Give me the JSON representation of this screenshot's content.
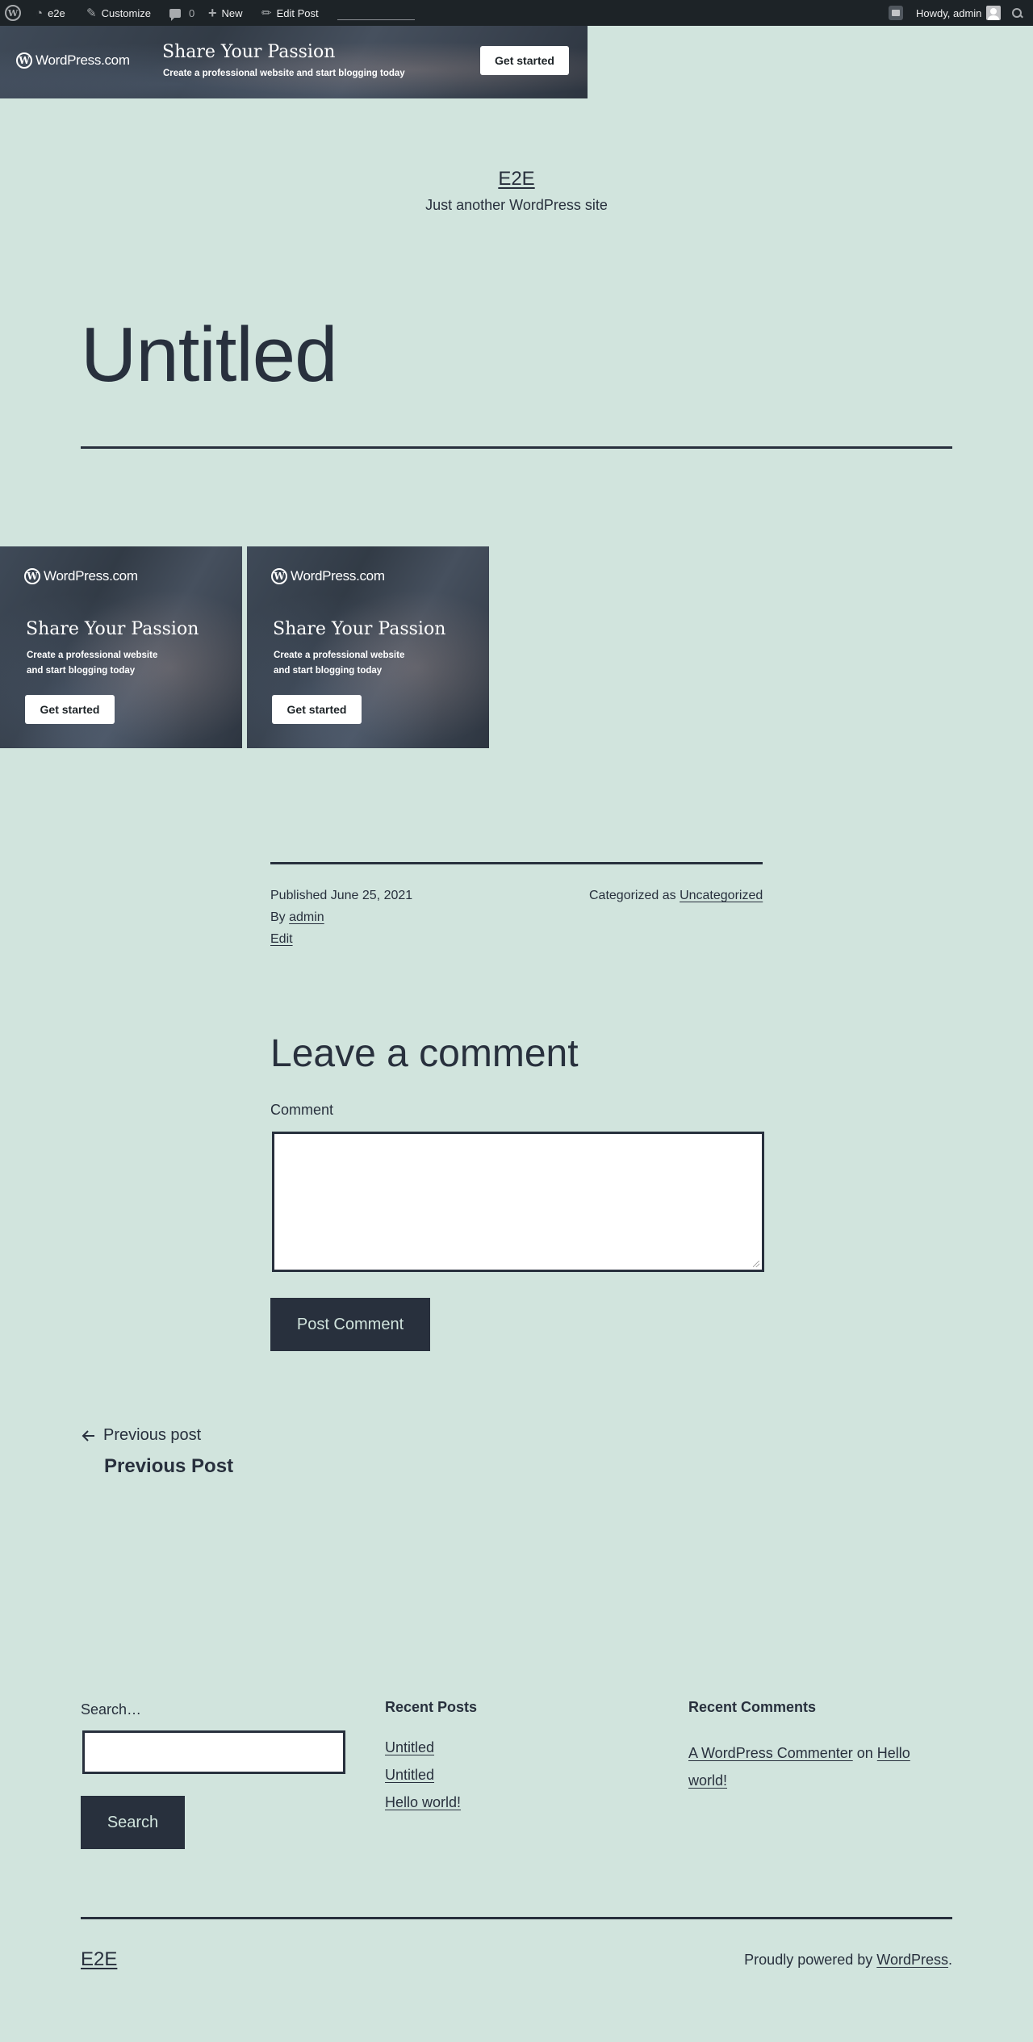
{
  "admin_bar": {
    "site_name": "e2e",
    "customize": "Customize",
    "comments_count": "0",
    "new": "New",
    "edit_post": "Edit Post",
    "howdy": "Howdy, admin"
  },
  "top_ad": {
    "logo_text": "WordPress.com",
    "title": "Share Your Passion",
    "subtitle": "Create a professional website and start blogging today",
    "button": "Get started"
  },
  "header": {
    "site_title": "E2E",
    "tagline": "Just another WordPress site"
  },
  "post": {
    "title": "Untitled"
  },
  "gallery_ads": [
    {
      "logo_text": "WordPress.com",
      "title": "Share Your Passion",
      "subtitle_line1": "Create a professional website",
      "subtitle_line2": "and start blogging today",
      "button": "Get started"
    },
    {
      "logo_text": "WordPress.com",
      "title": "Share Your Passion",
      "subtitle_line1": "Create a professional website",
      "subtitle_line2": "and start blogging today",
      "button": "Get started"
    }
  ],
  "post_meta": {
    "published_label": "Published",
    "published_date": "June 25, 2021",
    "by_label": "By",
    "author": "admin",
    "edit": "Edit",
    "categorized_label": "Categorized as",
    "category": "Uncategorized"
  },
  "comments": {
    "heading": "Leave a comment",
    "label": "Comment",
    "submit": "Post Comment"
  },
  "post_nav": {
    "previous_label": "Previous post",
    "previous_title": "Previous Post"
  },
  "footer_widgets": {
    "search_label": "Search…",
    "search_button": "Search",
    "recent_posts_heading": "Recent Posts",
    "recent_posts": [
      "Untitled",
      "Untitled",
      "Hello world!"
    ],
    "recent_comments_heading": "Recent Comments",
    "recent_comment_author": "A WordPress Commenter",
    "recent_comment_on": "on",
    "recent_comment_post_line1": "Hello",
    "recent_comment_post_line2": "world!"
  },
  "footer": {
    "site_title": "E2E",
    "powered_text": "Proudly powered by",
    "powered_link": "WordPress",
    "powered_suffix": "."
  }
}
